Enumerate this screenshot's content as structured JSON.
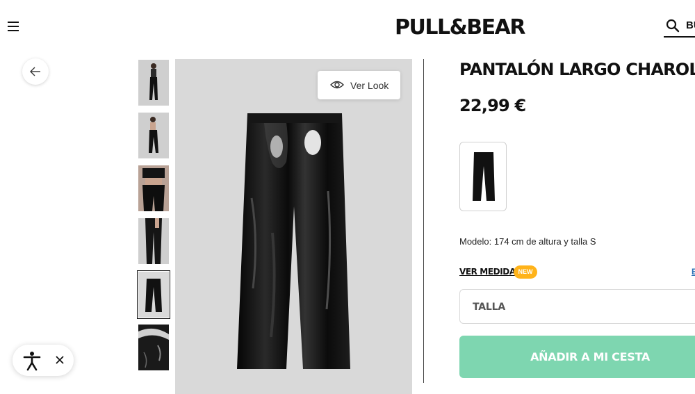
{
  "header": {
    "logo": "PULL&BEAR",
    "menu_icon": "hamburger-menu-icon",
    "search_icon": "search-icon",
    "search_label": "BUSCAR"
  },
  "navigation": {
    "back_icon": "arrow-left-icon"
  },
  "gallery": {
    "thumbnail_count": 6,
    "selected_thumbnail": 5,
    "ver_look_label": "Ver Look",
    "ver_look_icon": "eye-icon"
  },
  "product": {
    "title": "PANTALÓN LARGO CHAROL",
    "price": "22,99 €",
    "model_info": "Modelo: 174 cm de altura y talla S",
    "ver_medidas": "VER MEDIDAS",
    "new_badge": "NEW",
    "size_guide_label": "E",
    "size_placeholder": "TALLA",
    "add_to_cart": "AÑADIR A MI CESTA"
  },
  "accessibility": {
    "icon": "accessibility-person-icon",
    "close_icon": "close-icon"
  },
  "colors": {
    "accent_green": "#7ed6b0",
    "badge_orange": "#ffb31a",
    "image_background": "#d9d9d9",
    "text": "#111111"
  }
}
